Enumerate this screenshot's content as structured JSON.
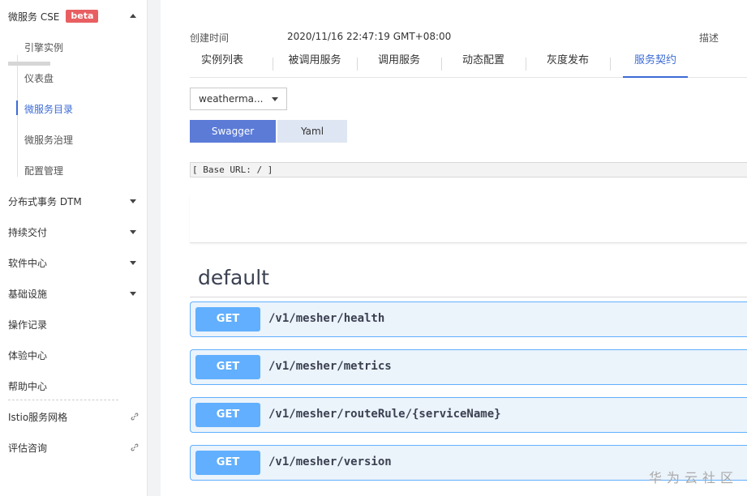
{
  "sidebar": {
    "cse_title": "微服务 CSE",
    "cse_badge": "beta",
    "sub_items": [
      {
        "label": "引擎实例"
      },
      {
        "label": "仪表盘"
      },
      {
        "label": "微服务目录"
      },
      {
        "label": "微服务治理"
      },
      {
        "label": "配置管理"
      }
    ],
    "groups": [
      {
        "label": "分布式事务 DTM"
      },
      {
        "label": "持续交付"
      },
      {
        "label": "软件中心"
      },
      {
        "label": "基础设施"
      }
    ],
    "items": [
      {
        "label": "操作记录"
      },
      {
        "label": "体验中心"
      },
      {
        "label": "帮助中心"
      }
    ],
    "external": [
      {
        "label": "Istio服务网格"
      },
      {
        "label": "评估咨询"
      }
    ]
  },
  "meta": {
    "created_label": "创建时间",
    "created_value": "2020/11/16 22:47:19 GMT+08:00",
    "desc_label": "描述"
  },
  "tabs": [
    {
      "label": "实例列表"
    },
    {
      "label": "被调用服务"
    },
    {
      "label": "调用服务"
    },
    {
      "label": "动态配置"
    },
    {
      "label": "灰度发布"
    },
    {
      "label": "服务契约"
    }
  ],
  "contract": {
    "select_value": "weatherma...",
    "swagger_label": "Swagger",
    "yaml_label": "Yaml",
    "base_url": "[ Base URL: / ]",
    "section_title": "default",
    "operations": [
      {
        "method": "GET",
        "path": "/v1/mesher/health"
      },
      {
        "method": "GET",
        "path": "/v1/mesher/metrics"
      },
      {
        "method": "GET",
        "path": "/v1/mesher/routeRule/{serviceName}"
      },
      {
        "method": "GET",
        "path": "/v1/mesher/version"
      }
    ]
  },
  "watermark": "华为云社区",
  "colors": {
    "accent": "#3c6bd6",
    "badge": "#e85f62",
    "get_method": "#61affe",
    "get_bg": "#ebf3fb"
  }
}
